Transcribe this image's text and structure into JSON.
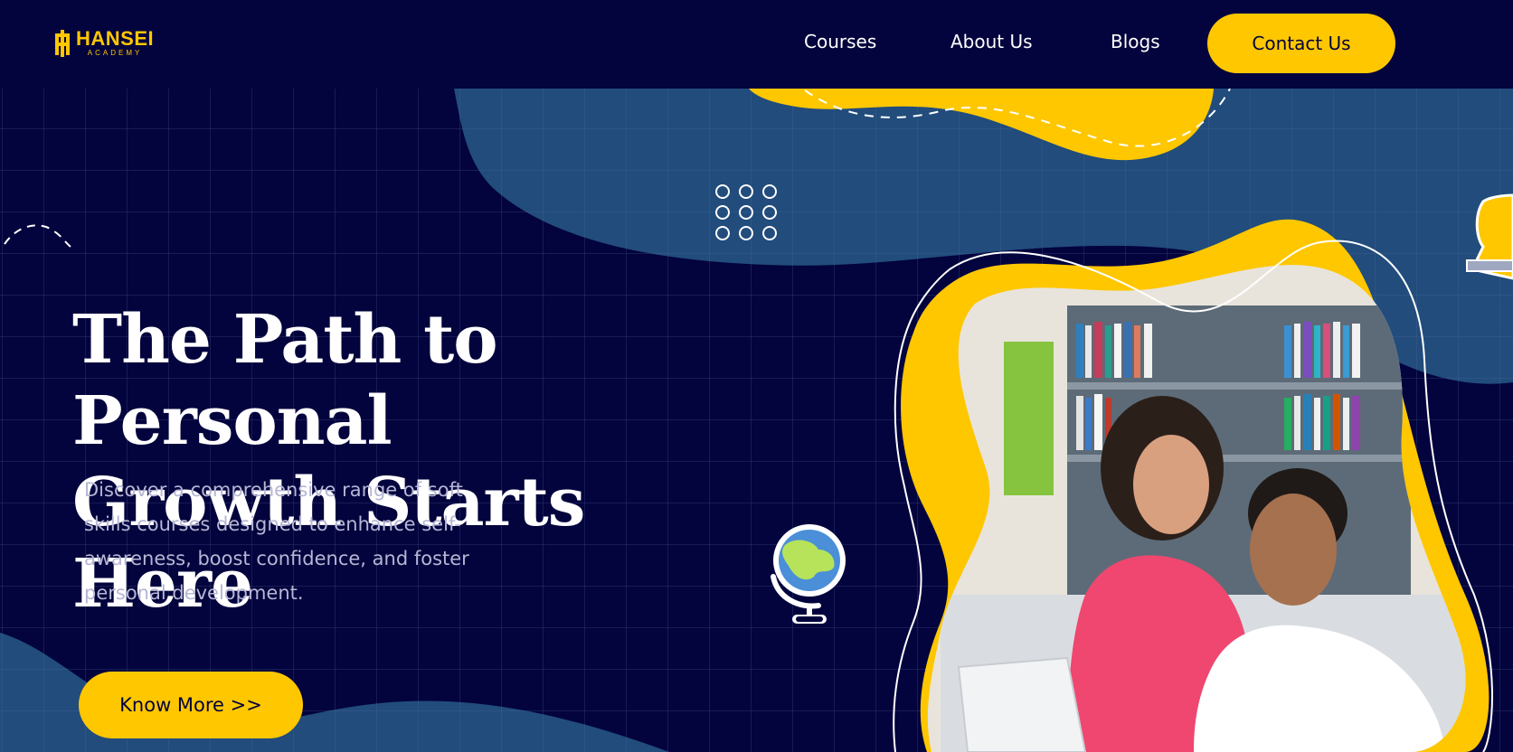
{
  "brand": {
    "name": "HANSEI",
    "sub": "ACADEMY",
    "color": "#ffc700"
  },
  "nav": {
    "items": [
      {
        "label": "Courses"
      },
      {
        "label": "About Us"
      },
      {
        "label": "Blogs"
      }
    ],
    "contact_label": "Contact Us"
  },
  "hero": {
    "title_line1": "The Path to Personal",
    "title_line2": "Growth Starts Here",
    "description": "Discover a comprehensive range of soft skills courses designed to enhance self-awareness, boost confidence, and foster personal development.",
    "cta_label": "Know More >>"
  },
  "colors": {
    "navy": "#03033d",
    "blue_blob": "#214c7c",
    "accent": "#ffc700",
    "text_muted": "#b6b6d6"
  },
  "icons": {
    "logo": "hansei-logo-icon",
    "globe": "globe-icon",
    "trophy": "trophy-icon",
    "dots": "dot-grid-icon"
  }
}
